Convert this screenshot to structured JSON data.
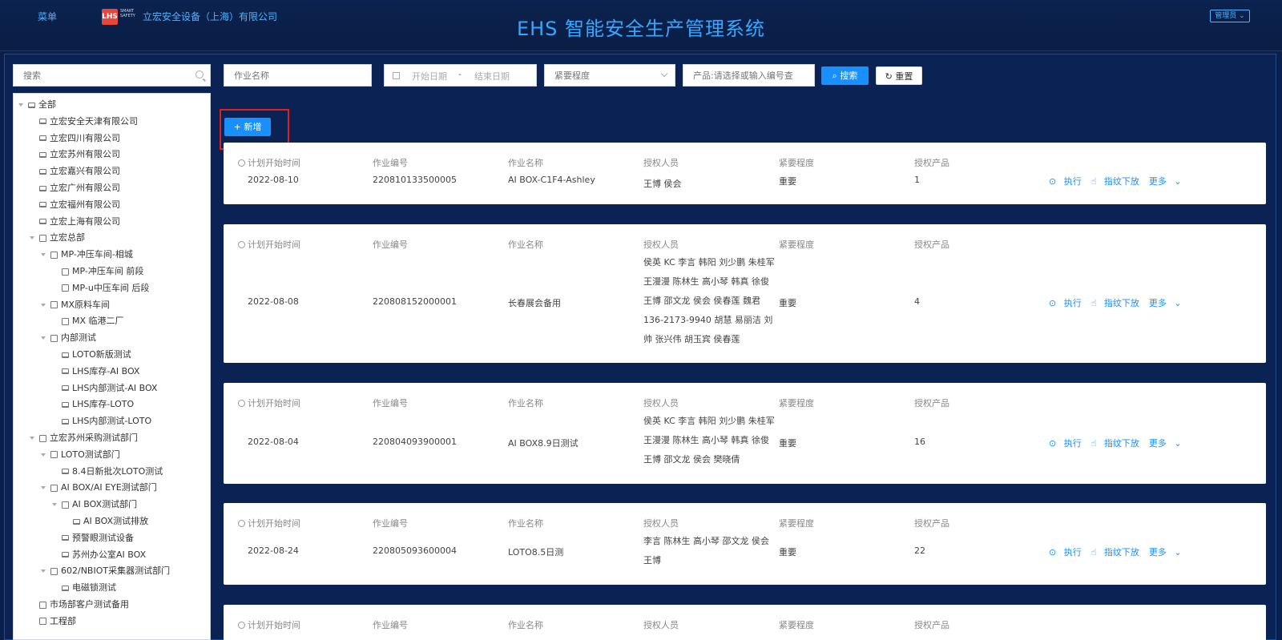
{
  "header": {
    "menu": "菜单",
    "logo_text": "LHS",
    "logo_sub": "SMART SAFETY",
    "company": "立宏安全设备（上海）有限公司",
    "title": "EHS 智能安全生产管理系统",
    "admin": "管理员"
  },
  "sidebar": {
    "search_placeholder": "搜索",
    "tree": [
      {
        "label": "全部",
        "level": 0,
        "expand": true,
        "icon": "monitor-icon"
      },
      {
        "label": "立宏安全天津有限公司",
        "level": 1,
        "expand": false,
        "icon": "monitor-icon"
      },
      {
        "label": "立宏四川有限公司",
        "level": 1,
        "expand": false,
        "icon": "monitor-icon"
      },
      {
        "label": "立宏苏州有限公司",
        "level": 1,
        "expand": false,
        "icon": "monitor-icon"
      },
      {
        "label": "立宏嘉兴有限公司",
        "level": 1,
        "expand": false,
        "icon": "monitor-icon"
      },
      {
        "label": "立宏广州有限公司",
        "level": 1,
        "expand": false,
        "icon": "monitor-icon"
      },
      {
        "label": "立宏福州有限公司",
        "level": 1,
        "expand": false,
        "icon": "monitor-icon"
      },
      {
        "label": "立宏上海有限公司",
        "level": 1,
        "expand": false,
        "icon": "monitor-icon"
      },
      {
        "label": "立宏总部",
        "level": 1,
        "expand": true,
        "icon": "document-icon"
      },
      {
        "label": "MP-冲压车间-相城",
        "level": 2,
        "expand": true,
        "icon": "document-icon"
      },
      {
        "label": "MP-冲压车间 前段",
        "level": 3,
        "expand": false,
        "icon": "document-icon"
      },
      {
        "label": "MP-u中压车间 后段",
        "level": 3,
        "expand": false,
        "icon": "document-icon"
      },
      {
        "label": "MX原料车间",
        "level": 2,
        "expand": true,
        "icon": "document-icon"
      },
      {
        "label": "MX 临港二厂",
        "level": 3,
        "expand": false,
        "icon": "document-icon"
      },
      {
        "label": "内部测试",
        "level": 2,
        "expand": true,
        "icon": "document-icon"
      },
      {
        "label": "LOTO新版测试",
        "level": 3,
        "expand": false,
        "icon": "monitor-icon"
      },
      {
        "label": "LHS库存-AI BOX",
        "level": 3,
        "expand": false,
        "icon": "monitor-icon"
      },
      {
        "label": "LHS内部测试-AI BOX",
        "level": 3,
        "expand": false,
        "icon": "monitor-icon"
      },
      {
        "label": "LHS库存-LOTO",
        "level": 3,
        "expand": false,
        "icon": "monitor-icon"
      },
      {
        "label": "LHS内部测试-LOTO",
        "level": 3,
        "expand": false,
        "icon": "monitor-icon"
      },
      {
        "label": "立宏苏州采购测试部门",
        "level": 1,
        "expand": true,
        "icon": "document-icon"
      },
      {
        "label": "LOTO测试部门",
        "level": 2,
        "expand": true,
        "icon": "document-icon"
      },
      {
        "label": "8.4日新批次LOTO测试",
        "level": 3,
        "expand": false,
        "icon": "monitor-icon"
      },
      {
        "label": "AI BOX/AI EYE测试部门",
        "level": 2,
        "expand": true,
        "icon": "document-icon"
      },
      {
        "label": "AI BOX测试部门",
        "level": 3,
        "expand": true,
        "icon": "document-icon"
      },
      {
        "label": "AI BOX测试排放",
        "level": 4,
        "expand": false,
        "icon": "monitor-icon"
      },
      {
        "label": "预警眼测试设备",
        "level": 3,
        "expand": false,
        "icon": "monitor-icon"
      },
      {
        "label": "苏州办公室AI BOX",
        "level": 3,
        "expand": false,
        "icon": "monitor-icon"
      },
      {
        "label": "602/NBIOT采集器测试部门",
        "level": 2,
        "expand": true,
        "icon": "document-icon"
      },
      {
        "label": "电磁锁测试",
        "level": 3,
        "expand": false,
        "icon": "monitor-icon"
      },
      {
        "label": "市场部客户测试备用",
        "level": 1,
        "expand": false,
        "icon": "document-icon"
      },
      {
        "label": "工程部",
        "level": 1,
        "expand": false,
        "icon": "document-icon"
      }
    ]
  },
  "filters": {
    "job_name_placeholder": "作业名称",
    "start_date": "开始日期",
    "date_sep": "-",
    "end_date": "结束日期",
    "urgency_placeholder": "紧要程度",
    "product_placeholder": "产品:请选择或输入编号查",
    "search": "搜索",
    "reset": "重置",
    "add": "新增"
  },
  "columns": {
    "start": "计划开始时间",
    "code": "作业编号",
    "name": "作业名称",
    "persons": "授权人员",
    "urgency": "紧要程度",
    "products": "授权产品"
  },
  "actions": {
    "execute": "执行",
    "issue": "指纹下放",
    "more": "更多"
  },
  "cards": [
    {
      "date": "2022-08-10",
      "code": "220810133500005",
      "name": "AI BOX-C1F4-Ashley",
      "persons": "王博 侯会",
      "urgency": "重要",
      "products": "1"
    },
    {
      "date": "2022-08-08",
      "code": "220808152000001",
      "name": "长春展会备用",
      "persons": "侯英 KC 李言 韩阳 刘少鹏 朱桂军 王漫漫 陈林生 高小琴 韩真 徐俊 王博 邵文龙 侯会 侯春莲 魏君 136-2173-9940 胡慧 易丽洁 刘帅 张兴伟 胡玉宾 侯春莲",
      "urgency": "重要",
      "products": "4"
    },
    {
      "date": "2022-08-04",
      "code": "220804093900001",
      "name": "AI BOX8.9日测试",
      "persons": "侯英 KC 李言 韩阳 刘少鹏 朱桂军 王漫漫 陈林生 高小琴 韩真 徐俊 王博 邵文龙 侯会 樊晓倩",
      "urgency": "重要",
      "products": "16"
    },
    {
      "date": "2022-08-24",
      "code": "220805093600004",
      "name": "LOTO8.5日测",
      "persons": "李言 陈林生 高小琴 邵文龙 侯会 王博",
      "urgency": "重要",
      "products": "22"
    },
    {
      "date": "",
      "code": "",
      "name": "",
      "persons": "",
      "urgency": "",
      "products": ""
    }
  ]
}
